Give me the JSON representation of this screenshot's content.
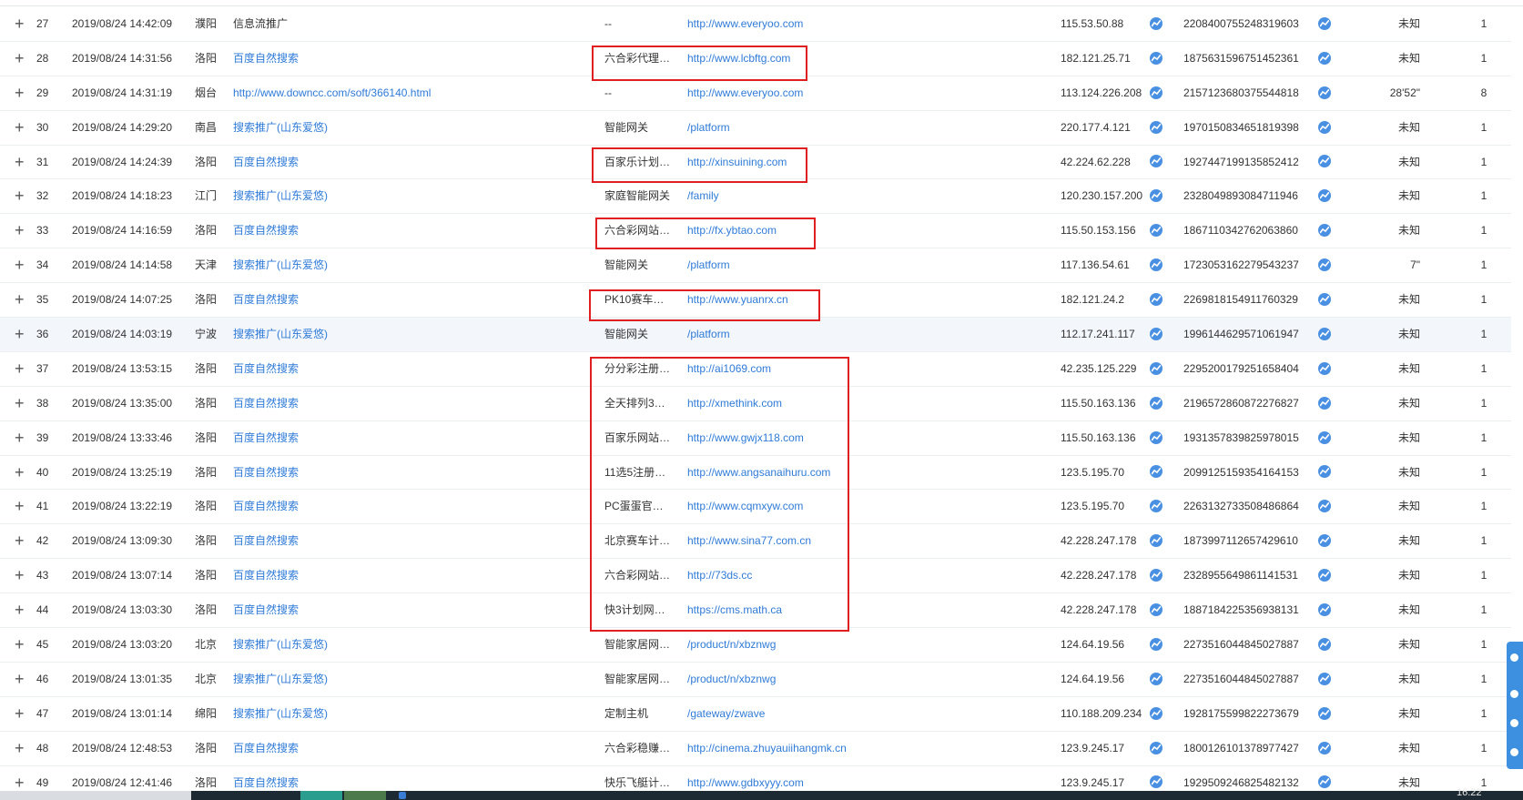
{
  "rows": [
    {
      "idx": "27",
      "time": "2019/08/24 14:42:09",
      "city": "濮阳",
      "source": "信息流推广",
      "source_link": false,
      "keyword": "--",
      "page": "http://www.everyoo.com",
      "ip": "115.53.50.88",
      "visitor_id": "2208400755248319603",
      "duration": "未知",
      "pv": "1"
    },
    {
      "idx": "28",
      "time": "2019/08/24 14:31:56",
      "city": "洛阳",
      "source": "百度自然搜索",
      "source_link": true,
      "keyword": "六合彩代理…",
      "page": "http://www.lcbftg.com",
      "ip": "182.121.25.71",
      "visitor_id": "1875631596751452361",
      "duration": "未知",
      "pv": "1"
    },
    {
      "idx": "29",
      "time": "2019/08/24 14:31:19",
      "city": "烟台",
      "source": "http://www.downcc.com/soft/366140.html",
      "source_link": true,
      "keyword": "--",
      "page": "http://www.everyoo.com",
      "ip": "113.124.226.208",
      "visitor_id": "2157123680375544818",
      "duration": "28'52\"",
      "pv": "8"
    },
    {
      "idx": "30",
      "time": "2019/08/24 14:29:20",
      "city": "南昌",
      "source": "搜索推广(山东爱悠)",
      "source_link": true,
      "keyword": "智能网关",
      "page": "/platform",
      "ip": "220.177.4.121",
      "visitor_id": "1970150834651819398",
      "duration": "未知",
      "pv": "1"
    },
    {
      "idx": "31",
      "time": "2019/08/24 14:24:39",
      "city": "洛阳",
      "source": "百度自然搜索",
      "source_link": true,
      "keyword": "百家乐计划…",
      "page": "http://xinsuining.com",
      "ip": "42.224.62.228",
      "visitor_id": "1927447199135852412",
      "duration": "未知",
      "pv": "1"
    },
    {
      "idx": "32",
      "time": "2019/08/24 14:18:23",
      "city": "江门",
      "source": "搜索推广(山东爱悠)",
      "source_link": true,
      "keyword": "家庭智能网关",
      "page": "/family",
      "ip": "120.230.157.200",
      "visitor_id": "2328049893084711946",
      "duration": "未知",
      "pv": "1"
    },
    {
      "idx": "33",
      "time": "2019/08/24 14:16:59",
      "city": "洛阳",
      "source": "百度自然搜索",
      "source_link": true,
      "keyword": "六合彩网站…",
      "page": "http://fx.ybtao.com",
      "ip": "115.50.153.156",
      "visitor_id": "1867110342762063860",
      "duration": "未知",
      "pv": "1"
    },
    {
      "idx": "34",
      "time": "2019/08/24 14:14:58",
      "city": "天津",
      "source": "搜索推广(山东爱悠)",
      "source_link": true,
      "keyword": "智能网关",
      "page": "/platform",
      "ip": "117.136.54.61",
      "visitor_id": "1723053162279543237",
      "duration": "7\"",
      "pv": "1"
    },
    {
      "idx": "35",
      "time": "2019/08/24 14:07:25",
      "city": "洛阳",
      "source": "百度自然搜索",
      "source_link": true,
      "keyword": "PK10赛车…",
      "page": "http://www.yuanrx.cn",
      "ip": "182.121.24.2",
      "visitor_id": "2269818154911760329",
      "duration": "未知",
      "pv": "1"
    },
    {
      "idx": "36",
      "time": "2019/08/24 14:03:19",
      "city": "宁波",
      "source": "搜索推广(山东爱悠)",
      "source_link": true,
      "keyword": "智能网关",
      "page": "/platform",
      "ip": "112.17.241.117",
      "visitor_id": "1996144629571061947",
      "duration": "未知",
      "pv": "1"
    },
    {
      "idx": "37",
      "time": "2019/08/24 13:53:15",
      "city": "洛阳",
      "source": "百度自然搜索",
      "source_link": true,
      "keyword": "分分彩注册…",
      "page": "http://ai1069.com",
      "ip": "42.235.125.229",
      "visitor_id": "2295200179251658404",
      "duration": "未知",
      "pv": "1"
    },
    {
      "idx": "38",
      "time": "2019/08/24 13:35:00",
      "city": "洛阳",
      "source": "百度自然搜索",
      "source_link": true,
      "keyword": "全天排列3…",
      "page": "http://xmethink.com",
      "ip": "115.50.163.136",
      "visitor_id": "2196572860872276827",
      "duration": "未知",
      "pv": "1"
    },
    {
      "idx": "39",
      "time": "2019/08/24 13:33:46",
      "city": "洛阳",
      "source": "百度自然搜索",
      "source_link": true,
      "keyword": "百家乐网站…",
      "page": "http://www.gwjx118.com",
      "ip": "115.50.163.136",
      "visitor_id": "1931357839825978015",
      "duration": "未知",
      "pv": "1"
    },
    {
      "idx": "40",
      "time": "2019/08/24 13:25:19",
      "city": "洛阳",
      "source": "百度自然搜索",
      "source_link": true,
      "keyword": "11选5注册…",
      "page": "http://www.angsanaihuru.com",
      "ip": "123.5.195.70",
      "visitor_id": "2099125159354164153",
      "duration": "未知",
      "pv": "1"
    },
    {
      "idx": "41",
      "time": "2019/08/24 13:22:19",
      "city": "洛阳",
      "source": "百度自然搜索",
      "source_link": true,
      "keyword": "PC蛋蛋官…",
      "page": "http://www.cqmxyw.com",
      "ip": "123.5.195.70",
      "visitor_id": "2263132733508486864",
      "duration": "未知",
      "pv": "1"
    },
    {
      "idx": "42",
      "time": "2019/08/24 13:09:30",
      "city": "洛阳",
      "source": "百度自然搜索",
      "source_link": true,
      "keyword": "北京赛车计…",
      "page": "http://www.sina77.com.cn",
      "ip": "42.228.247.178",
      "visitor_id": "1873997112657429610",
      "duration": "未知",
      "pv": "1"
    },
    {
      "idx": "43",
      "time": "2019/08/24 13:07:14",
      "city": "洛阳",
      "source": "百度自然搜索",
      "source_link": true,
      "keyword": "六合彩网站…",
      "page": "http://73ds.cc",
      "ip": "42.228.247.178",
      "visitor_id": "2328955649861141531",
      "duration": "未知",
      "pv": "1"
    },
    {
      "idx": "44",
      "time": "2019/08/24 13:03:30",
      "city": "洛阳",
      "source": "百度自然搜索",
      "source_link": true,
      "keyword": "快3计划网…",
      "page": "https://cms.math.ca",
      "ip": "42.228.247.178",
      "visitor_id": "1887184225356938131",
      "duration": "未知",
      "pv": "1"
    },
    {
      "idx": "45",
      "time": "2019/08/24 13:03:20",
      "city": "北京",
      "source": "搜索推广(山东爱悠)",
      "source_link": true,
      "keyword": "智能家居网…",
      "page": "/product/n/xbznwg",
      "ip": "124.64.19.56",
      "visitor_id": "2273516044845027887",
      "duration": "未知",
      "pv": "1"
    },
    {
      "idx": "46",
      "time": "2019/08/24 13:01:35",
      "city": "北京",
      "source": "搜索推广(山东爱悠)",
      "source_link": true,
      "keyword": "智能家居网…",
      "page": "/product/n/xbznwg",
      "ip": "124.64.19.56",
      "visitor_id": "2273516044845027887",
      "duration": "未知",
      "pv": "1"
    },
    {
      "idx": "47",
      "time": "2019/08/24 13:01:14",
      "city": "绵阳",
      "source": "搜索推广(山东爱悠)",
      "source_link": true,
      "keyword": "定制主机",
      "page": "/gateway/zwave",
      "ip": "110.188.209.234",
      "visitor_id": "1928175599822273679",
      "duration": "未知",
      "pv": "1"
    },
    {
      "idx": "48",
      "time": "2019/08/24 12:48:53",
      "city": "洛阳",
      "source": "百度自然搜索",
      "source_link": true,
      "keyword": "六合彩稳赚…",
      "page": "http://cinema.zhuyauiihangmk.cn",
      "ip": "123.9.245.17",
      "visitor_id": "1800126101378977427",
      "duration": "未知",
      "pv": "1"
    },
    {
      "idx": "49",
      "time": "2019/08/24 12:41:46",
      "city": "洛阳",
      "source": "百度自然搜索",
      "source_link": true,
      "keyword": "快乐飞艇计…",
      "page": "http://www.gdbxyyy.com",
      "ip": "123.9.245.17",
      "visitor_id": "1929509246825482132",
      "duration": "未知",
      "pv": "1"
    }
  ],
  "expand_symbol": "+",
  "taskbar": {
    "clock": "16:22"
  },
  "colors": {
    "link": "#2f7bd8",
    "highlight_box": "#e02020",
    "icon": "#4a90e2",
    "row_hover": "#f3f6fb"
  },
  "icons": {
    "trend": "trend-chart-icon"
  }
}
